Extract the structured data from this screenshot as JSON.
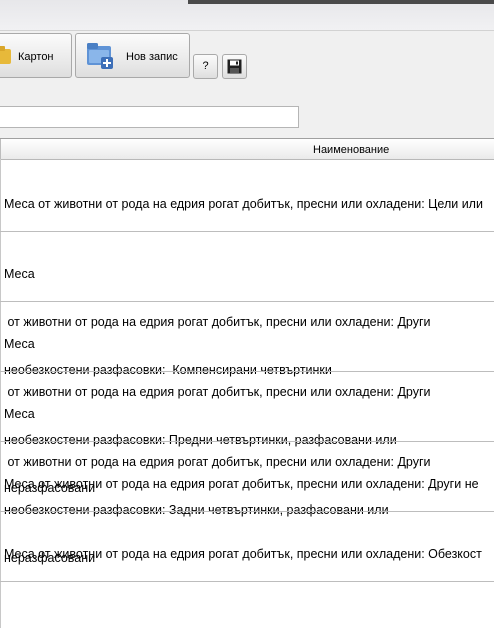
{
  "toolbar": {
    "karton_label": "Картон",
    "new_record_label": "Нов запис",
    "help_label": "?"
  },
  "filter": {
    "value": ""
  },
  "grid": {
    "column_header": "Наименование",
    "rows": [
      {
        "line1": "Меса от животни от рода на едрия рогат добитък, пресни или охладени: Цели или",
        "line2": "",
        "line3": ""
      },
      {
        "line1": "Меса",
        "line2": " от животни от рода на едрия рогат добитък, пресни или охладени: Други",
        "line3": "необезкостени разфасовки:  Компенсирани четвъртинки"
      },
      {
        "line1": "Меса",
        "line2": " от животни от рода на едрия рогат добитък, пресни или охладени: Други",
        "line3": "необезкостени разфасовки: Предни четвъртинки, разфасовани или",
        "line4": "неразфасовани"
      },
      {
        "line1": "Меса",
        "line2": " от животни от рода на едрия рогат добитък, пресни или охладени: Други",
        "line3": "необезкостени разфасовки: Задни четвъртинки, разфасовани или",
        "line4": "неразфасовани"
      },
      {
        "line1": "Меса от животни от рода на едрия рогат добитък, пресни или охладени: Други не",
        "line2": "",
        "line3": ""
      },
      {
        "line1": "Меса от животни от рода на едрия рогат добитък, пресни или охладени: Обезкост",
        "line2": "",
        "line3": ""
      }
    ]
  }
}
